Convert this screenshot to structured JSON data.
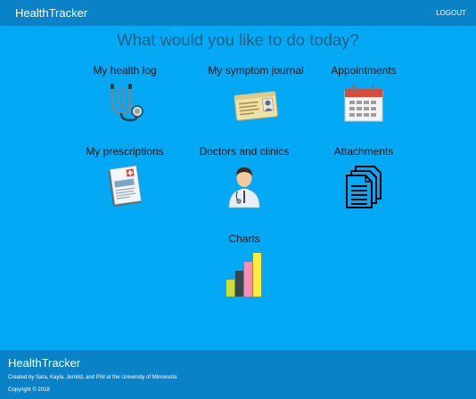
{
  "nav": {
    "brand": "HealthTracker",
    "logout": "LOGOUT"
  },
  "main": {
    "heading": "What would you like to do today?",
    "tiles": [
      {
        "label": "My health log",
        "icon": "stethoscope-icon"
      },
      {
        "label": "My symptom journal",
        "icon": "id-card-icon"
      },
      {
        "label": "Appointments",
        "icon": "calendar-icon"
      },
      {
        "label": "My prescriptions",
        "icon": "prescription-icon"
      },
      {
        "label": "Doctors and clinics",
        "icon": "doctor-icon"
      },
      {
        "label": "Attachments",
        "icon": "documents-icon"
      },
      {
        "label": "Charts",
        "icon": "bar-chart-icon"
      }
    ]
  },
  "footer": {
    "title": "HealthTracker",
    "credit": "Created by Sara, Kayla, Jerridd, and Phil at the University of Minnesota",
    "copyright": "Copyright © 2018"
  },
  "colors": {
    "background": "#03a9f4",
    "bar": "#0a82c8",
    "heading": "#1f5f85"
  }
}
